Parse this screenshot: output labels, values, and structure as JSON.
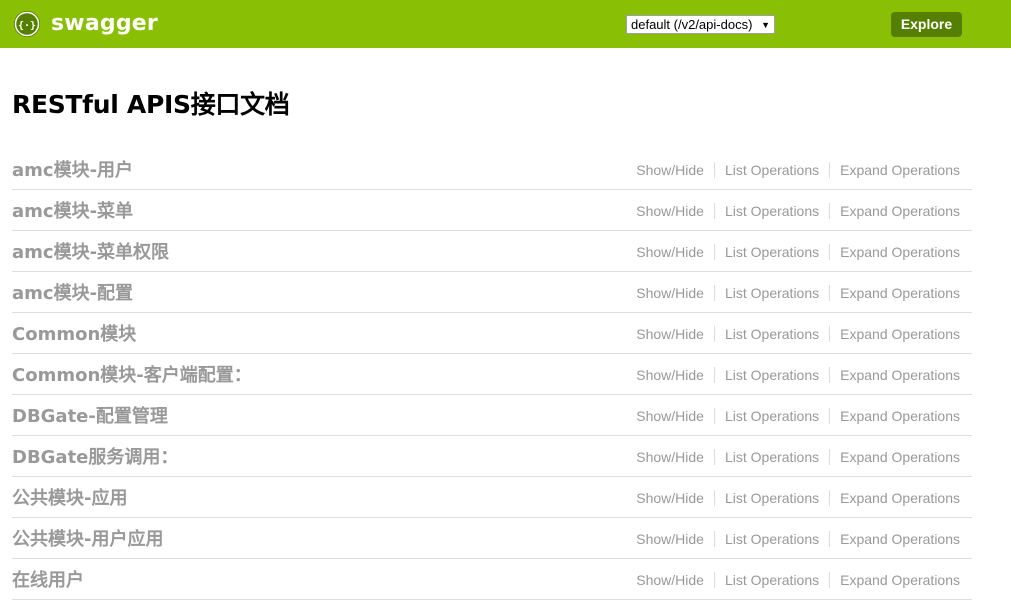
{
  "header": {
    "brand": "swagger",
    "logo_icon": "swagger-logo-icon",
    "logo_glyph": "{···}",
    "spec_select": {
      "selected": "default (/v2/api-docs)",
      "arrow": "▼"
    },
    "explore_label": "Explore",
    "colors": {
      "bar": "#89bf04",
      "explore_button": "#547f00"
    }
  },
  "page_title": "RESTful APIS接口文档",
  "op_labels": {
    "show_hide": "Show/Hide",
    "list_operations": "List Operations",
    "expand_operations": "Expand Operations"
  },
  "resources": [
    {
      "name": "amc模块-用户"
    },
    {
      "name": "amc模块-菜单"
    },
    {
      "name": "amc模块-菜单权限"
    },
    {
      "name": "amc模块-配置"
    },
    {
      "name": "Common模块"
    },
    {
      "name": "Common模块-客户端配置："
    },
    {
      "name": "DBGate-配置管理"
    },
    {
      "name": "DBGate服务调用："
    },
    {
      "name": "公共模块-应用"
    },
    {
      "name": "公共模块-用户应用"
    },
    {
      "name": "在线用户"
    }
  ],
  "colors": {
    "resource_text": "#999999",
    "divider": "#dddddd"
  }
}
